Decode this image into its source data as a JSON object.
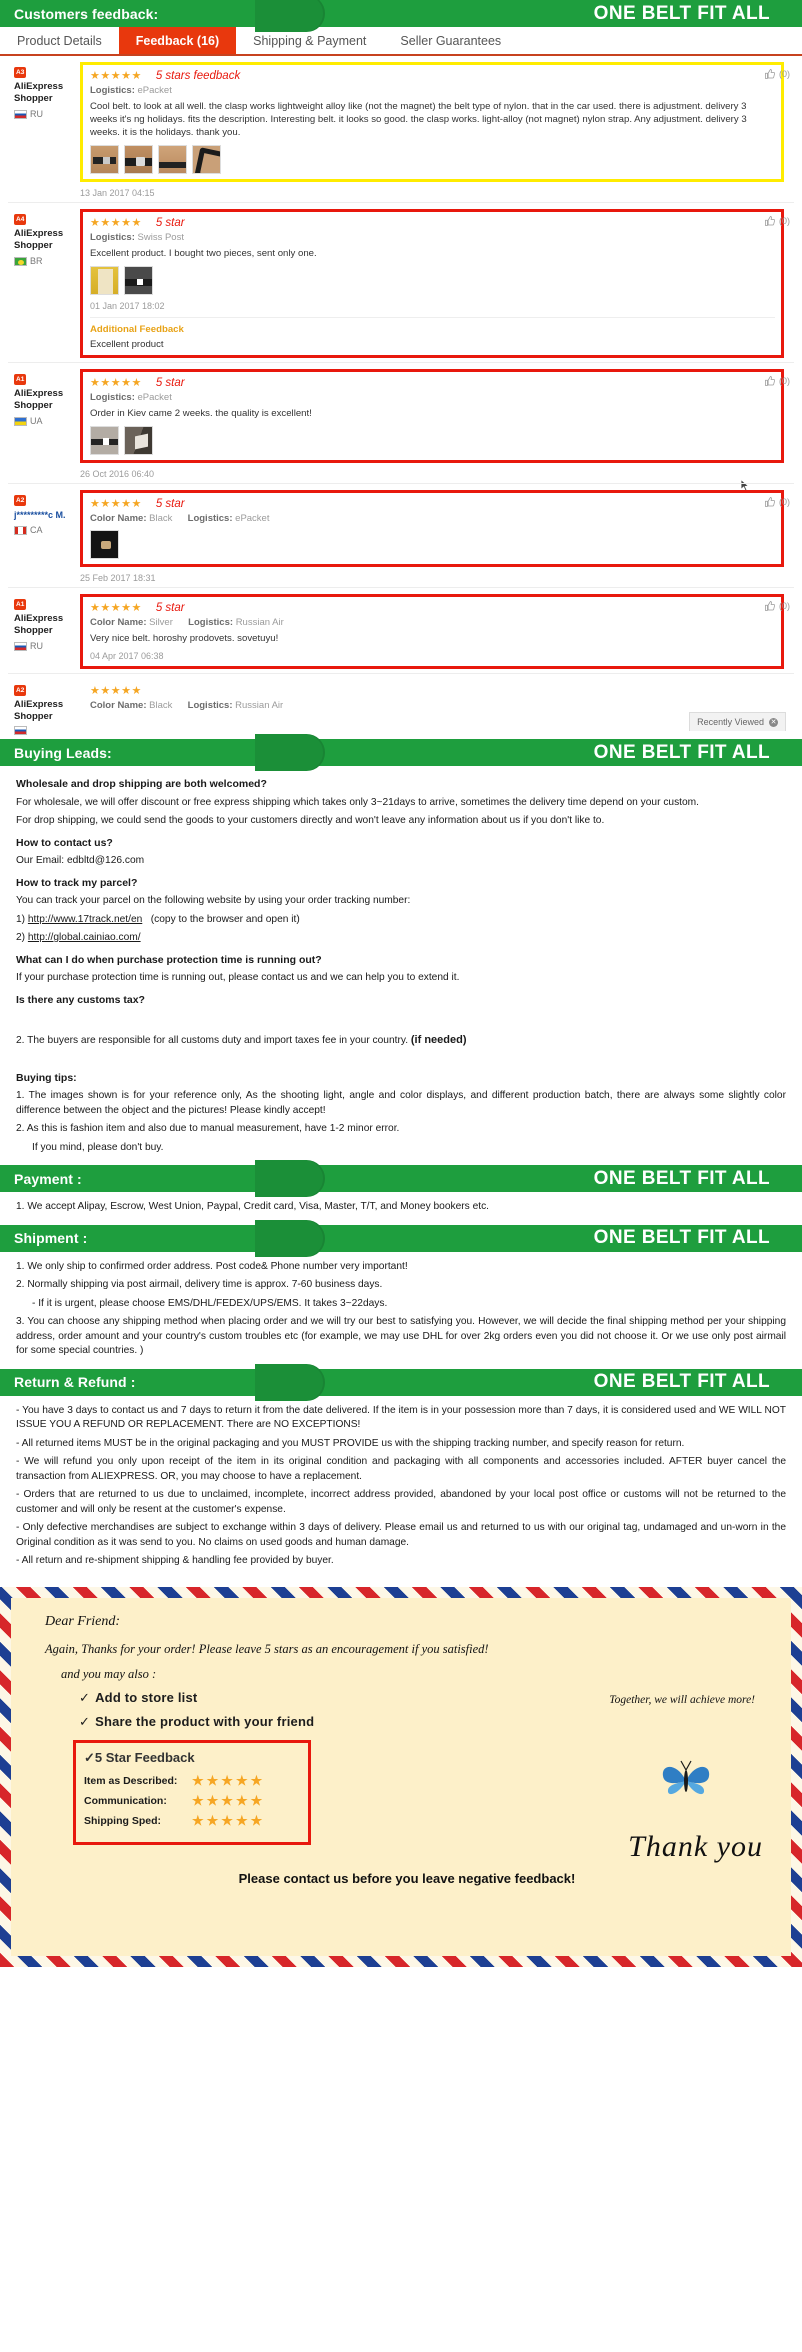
{
  "banners": {
    "feedback": {
      "left_label": "Customers feedback:",
      "brand": "ONE BELT FIT ALL"
    },
    "buying_leads": {
      "left_label": "Buying Leads:",
      "brand": "ONE BELT FIT ALL"
    },
    "payment": {
      "left_label": "Payment :",
      "brand": "ONE BELT FIT ALL"
    },
    "shipment": {
      "left_label": "Shipment :",
      "brand": "ONE BELT FIT ALL"
    },
    "return": {
      "left_label": "Return & Refund :",
      "brand": "ONE BELT FIT ALL"
    }
  },
  "tabs": [
    {
      "label": "Product Details",
      "active": false
    },
    {
      "label": "Feedback (16)",
      "active": true
    },
    {
      "label": "Shipping & Payment",
      "active": false
    },
    {
      "label": "Seller Guarantees",
      "active": false
    }
  ],
  "reviews": [
    {
      "user": "AliExpress Shopper",
      "badge": "A3",
      "country": "RU",
      "stars": "★★★★★",
      "rate_note": "5 stars feedback",
      "logistics_label": "Logistics:",
      "logistics_value": "ePacket",
      "text": "Cool belt. to look at all well. the clasp works lightweight alloy like (not the magnet) the belt type of nylon. that in the car used. there is adjustment. delivery 3 weeks it's ng holidays. fits the description. Interesting belt. it looks so good. the clasp works. light-alloy (not magnet) nylon strap. Any adjustment. delivery 3 weeks. it is the holidays. thank you.",
      "date": "13 Jan 2017 04:15",
      "helpful_count": "(0)",
      "thumb_count": 4
    },
    {
      "user": "AliExpress Shopper",
      "badge": "A4",
      "country": "BR",
      "stars": "★★★★★",
      "rate_note": "5 star",
      "logistics_label": "Logistics:",
      "logistics_value": "Swiss Post",
      "text": "Excellent product. I bought two pieces, sent only one.",
      "date": "01 Jan 2017 18:02",
      "helpful_count": "(0)",
      "thumb_count": 2,
      "additional_title": "Additional Feedback",
      "additional_text": "Excellent product"
    },
    {
      "user": "AliExpress Shopper",
      "badge": "A1",
      "country": "UA",
      "stars": "★★★★★",
      "rate_note": "5 star",
      "logistics_label": "Logistics:",
      "logistics_value": "ePacket",
      "text": "Order in Kiev came 2 weeks. the quality is excellent!",
      "date": "26 Oct 2016 06:40",
      "helpful_count": "(0)",
      "thumb_count": 2
    },
    {
      "user": "j*********c M.",
      "badge": "A2",
      "country": "CA",
      "stars": "★★★★★",
      "rate_note": "5 star",
      "color_label": "Color Name:",
      "color_value": "Black",
      "logistics_label": "Logistics:",
      "logistics_value": "ePacket",
      "text": "",
      "date": "25 Feb 2017 18:31",
      "helpful_count": "(0)",
      "thumb_count": 1
    },
    {
      "user": "AliExpress Shopper",
      "badge": "A1",
      "country": "RU",
      "stars": "★★★★★",
      "rate_note": "5 star",
      "color_label": "Color Name:",
      "color_value": "Silver",
      "logistics_label": "Logistics:",
      "logistics_value": "Russian Air",
      "text": "Very nice belt. horoshy prodovets. sovetuyu!",
      "date": "04 Apr 2017 06:38",
      "helpful_count": "(0)",
      "thumb_count": 0
    },
    {
      "user": "AliExpress Shopper",
      "badge": "A2",
      "country": "RU",
      "stars": "★★★★★",
      "rate_note": "",
      "color_label": "Color Name:",
      "color_value": "Black",
      "logistics_label": "Logistics:",
      "logistics_value": "Russian Air",
      "text": "",
      "date": "",
      "helpful_count": "",
      "thumb_count": 0
    }
  ],
  "recently_viewed": {
    "label": "Recently Viewed",
    "close": "✕"
  },
  "buying_leads": {
    "q1": "Wholesale and drop shipping are both welcomed?",
    "p1": "For wholesale, we will offer discount or free express shipping which takes only 3~21days to arrive, sometimes the delivery time depend on your custom.",
    "p2": "For drop shipping, we could send the goods to your customers directly and won't leave any information about us if you don't like to.",
    "q2": "How to contact us?",
    "p3": "Our Email: edbltd@126.com",
    "q3": "How to track my parcel?",
    "p4": "You can track your parcel on the following website by using your order tracking number:",
    "link1_prefix": "1) ",
    "link1": "http://www.17track.net/en",
    "link1_suffix": "(copy to the browser and open it)",
    "link2_prefix": "2) ",
    "link2": "http://global.cainiao.com/",
    "q4": "What can I do when purchase protection time is running out?",
    "p5": "If your purchase protection time is running out, please contact us and we can help you to extend it.",
    "q5": "Is there any customs tax?",
    "p6_normal": "2. The buyers are responsible for all customs duty and import taxes fee in your country.",
    "p6_bold": "(if needed)",
    "q6": "Buying tips:",
    "tip1": "1. The images shown is for your reference only, As the shooting light, angle and color displays, and different production batch, there are always some slightly color difference between the object and the pictures! Please kindly accept!",
    "tip2": "2. As this is fashion item and also due to manual measurement, have 1-2 minor error.",
    "tip3": "If you mind, please don't buy."
  },
  "payment": {
    "line1": "1. We accept Alipay, Escrow, West Union, Paypal, Credit card, Visa, Master, T/T, and Money bookers etc."
  },
  "shipment": {
    "line1": "1. We only ship to confirmed order address. Post code& Phone number very important!",
    "line2": "2. Normally shipping via post airmail, delivery time is approx. 7-60 business days.",
    "line3": "- If it is urgent, please choose EMS/DHL/FEDEX/UPS/EMS. It takes 3~22days.",
    "line4": "3. You can choose any shipping method when placing order and we will try our best to satisfying you. However, we will decide the final shipping method per your shipping address, order amount and your country's custom troubles etc (for example, we may use DHL for over 2kg orders even you did not choose it. Or we use only post airmail for some special countries. )"
  },
  "returns": {
    "line1": "- You have 3 days to contact us and 7 days to return it from the date delivered. If the item is in your possession more than 7 days, it is considered used and WE WILL NOT ISSUE YOU A REFUND OR REPLACEMENT. There are NO EXCEPTIONS!",
    "line2": "- All returned items MUST be in the original packaging and you MUST PROVIDE us with the shipping tracking number, and specify reason for return.",
    "line3": "- We will refund you only upon receipt of the item in its original condition and packaging with all components and accessories included. AFTER buyer cancel the transaction from ALIEXPRESS. OR, you may choose to have a replacement.",
    "line4": "- Orders that are returned to us due to unclaimed, incomplete, incorrect address provided, abandoned by your local post office or customs will not be returned to the customer and will only be resent at the customer's expense.",
    "line5": "- Only defective merchandises are subject to exchange within 3 days of delivery. Please email us and returned to us with our original tag, undamaged and un-worn in the Original condition as it was send to you. No claims on used goods and human damage.",
    "line6": "- All return and re-shipment shipping & handling fee provided by buyer."
  },
  "envelope": {
    "greeting": "Dear Friend:",
    "line1": "Again, Thanks for your order! Please leave 5 stars as an encouragement if you satisfied!",
    "line2": "and you may also :",
    "check1": "Add to store list",
    "check2": "Share the product with your friend",
    "check3": "5 Star Feedback",
    "tick": "✓",
    "ratings": [
      {
        "label": "Item as Described:",
        "stars": "★★★★★"
      },
      {
        "label": "Communication:",
        "stars": "★★★★★"
      },
      {
        "label": "Shipping Sped:",
        "stars": "★★★★★"
      }
    ],
    "together": "Together, we will achieve more!",
    "thank_you": "Thank you",
    "footer": "Please contact us before you leave negative feedback!"
  }
}
